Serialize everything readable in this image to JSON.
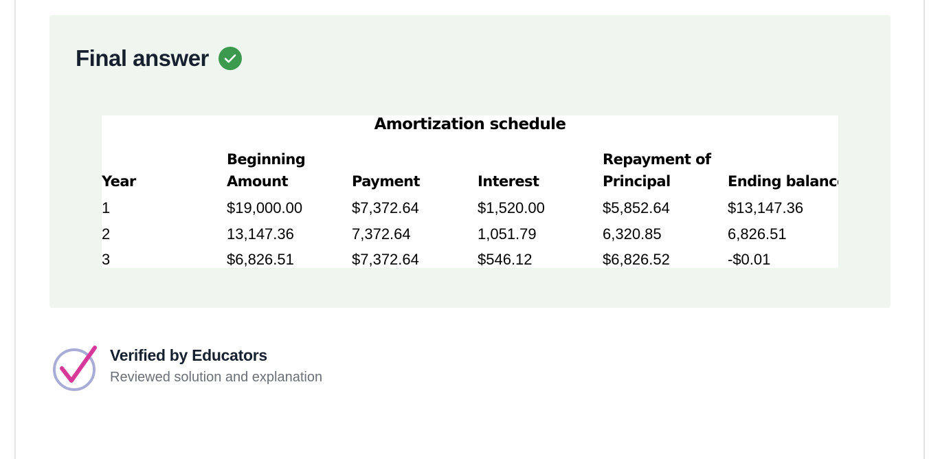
{
  "answer": {
    "title": "Final answer",
    "icon": "check-circle-icon",
    "accent_color": "#3b9a4e",
    "background_color": "#eff6ef"
  },
  "schedule": {
    "title": "Amortization schedule",
    "headers": {
      "year": [
        "Year"
      ],
      "beginning": [
        "Beginning",
        "Amount"
      ],
      "payment": [
        "Payment"
      ],
      "interest": [
        "Interest"
      ],
      "repayment": [
        "Repayment of",
        "Principal"
      ],
      "ending": [
        "Ending balance"
      ]
    },
    "rows": [
      [
        "1",
        "$19,000.00",
        "$7,372.64",
        "$1,520.00",
        "$5,852.64",
        "$13,147.36"
      ],
      [
        "2",
        "13,147.36",
        "7,372.64",
        "1,051.79",
        "6,320.85",
        "6,826.51"
      ],
      [
        "3",
        "$6,826.51",
        "$7,372.64",
        "$546.12",
        "$6,826.52",
        "-$0.01"
      ]
    ]
  },
  "verified": {
    "title": "Verified by Educators",
    "subtitle": "Reviewed solution and explanation",
    "icon": "verified-check-icon"
  }
}
